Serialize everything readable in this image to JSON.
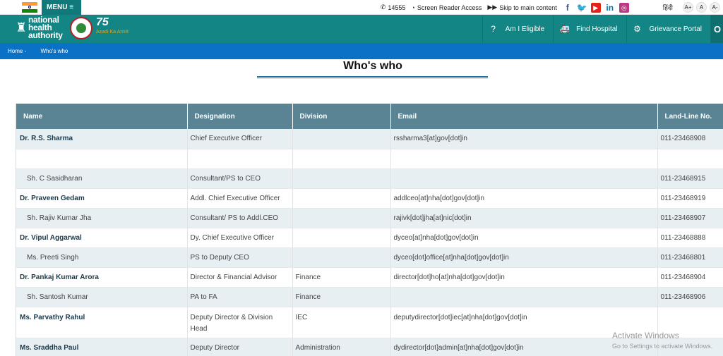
{
  "topbar": {
    "menu_label": "MENU ≡",
    "helpline": "14555",
    "screen_reader": "Screen Reader Access",
    "skip_main": "Skip to main content",
    "language": "हिंदी",
    "font_large": "A+",
    "font_normal": "A",
    "font_small": "A-"
  },
  "header": {
    "logo_text_1": "national",
    "logo_text_2": "health",
    "logo_text_3": "authority",
    "logo_75": "75",
    "logo_azadi": "Azadi Ka Amrit",
    "nav": [
      {
        "label": "Am I Eligible"
      },
      {
        "label": "Find Hospital"
      },
      {
        "label": "Grievance Portal"
      }
    ]
  },
  "breadcrumb": {
    "home": "Home -",
    "current": "Who's who"
  },
  "page_title": "Who's who",
  "table": {
    "headers": [
      "Name",
      "Designation",
      "Division",
      "Email",
      "Land-Line No."
    ],
    "rows": [
      {
        "name": "Dr. R.S. Sharma",
        "designation": "Chief Executive Officer",
        "division": "",
        "email": "rssharma3[at]gov[dot]in",
        "phone": "011-23468908"
      },
      {
        "name": "",
        "designation": "",
        "division": "",
        "email": "",
        "phone": ""
      },
      {
        "name": "Sh. C Sasidharan",
        "designation": "Consultant/PS to CEO",
        "division": "",
        "email": "",
        "phone": "011-23468915"
      },
      {
        "name": "Dr. Praveen Gedam",
        "designation": "Addl. Chief Executive Officer",
        "division": "",
        "email": "addlceo[at]nha[dot]gov[dot]in",
        "phone": "011-23468919"
      },
      {
        "name": "Sh. Rajiv Kumar Jha",
        "designation": "Consultant/ PS to Addl.CEO",
        "division": "",
        "email": "rajivk[dot]jha[at]nic[dot]in",
        "phone": "011-23468907"
      },
      {
        "name": "Dr. Vipul Aggarwal",
        "designation": "Dy. Chief Executive Officer",
        "division": "",
        "email": "dyceo[at]nha[dot]gov[dot]in",
        "phone": "011-23468888"
      },
      {
        "name": "Ms. Preeti Singh",
        "designation": "PS to Deputy CEO",
        "division": "",
        "email": "dyceo[dot]office[at]nha[dot]gov[dot]in",
        "phone": "011-23468801"
      },
      {
        "name": "Dr. Pankaj Kumar Arora",
        "designation": "Director & Financial Advisor",
        "division": "Finance",
        "email": "director[dot]ho[at]nha[dot]gov[dot]in",
        "phone": "011-23468904"
      },
      {
        "name": "Sh. Santosh Kumar",
        "designation": "PA to FA",
        "division": "Finance",
        "email": "",
        "phone": "011-23468906"
      },
      {
        "name": "Ms. Parvathy Rahul",
        "designation": "Deputy Director & Division Head",
        "division": "IEC",
        "email": "deputydirector[dot]iec[at]nha[dot]gov[dot]in",
        "phone": ""
      },
      {
        "name": "Ms. Sraddha Paul",
        "designation": "Deputy Director",
        "division": "Administration",
        "email": "dydirector[dot]admin[at]nha[dot]gov[dot]in",
        "phone": ""
      }
    ]
  },
  "watermark": {
    "line1": "Activate Windows",
    "line2": "Go to Settings to activate Windows."
  },
  "colors": {
    "header_bg": "#148585",
    "breadcrumb_bg": "#0a72c6",
    "table_header_bg": "#5a8394",
    "row_alt_bg": "#e7eff3"
  }
}
